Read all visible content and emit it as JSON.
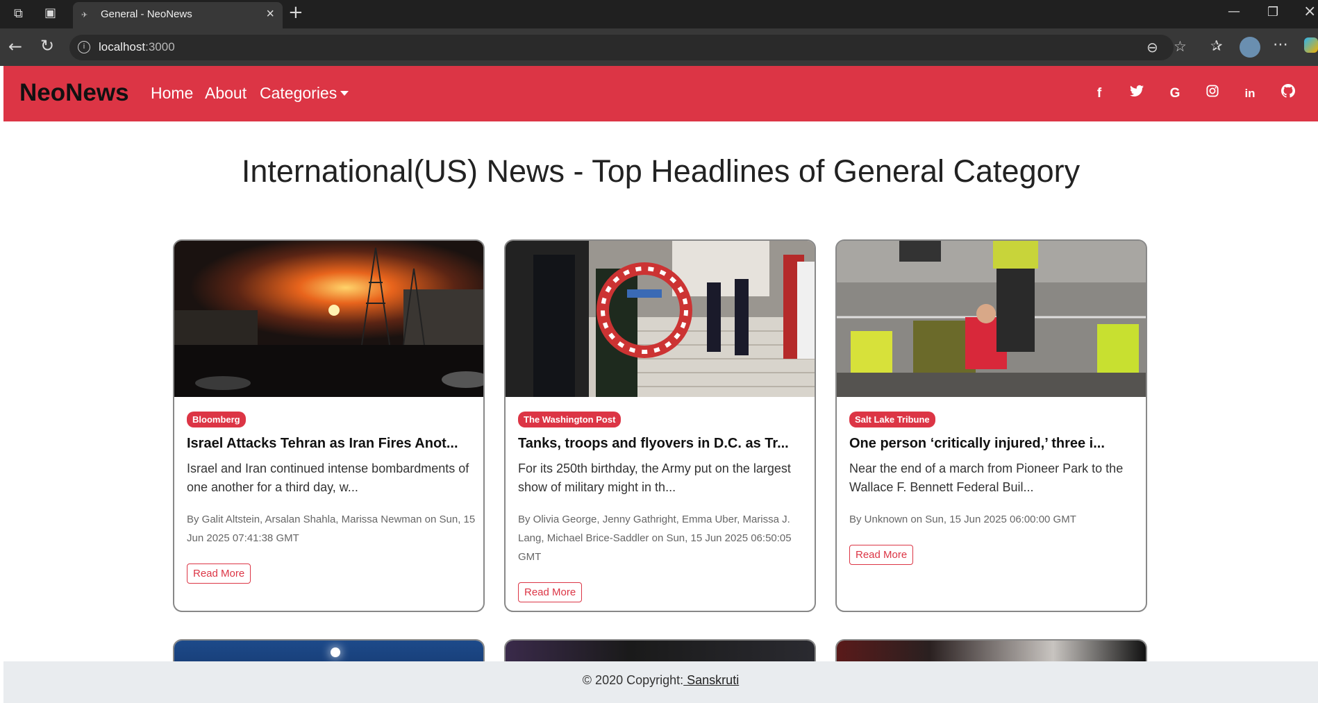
{
  "browser": {
    "tab_title": "General - NeoNews",
    "url_host": "localhost",
    "url_port": ":3000"
  },
  "navbar": {
    "brand": "NeoNews",
    "links": [
      "Home",
      "About",
      "Categories"
    ],
    "social": [
      "facebook-icon",
      "twitter-icon",
      "google-icon",
      "instagram-icon",
      "linkedin-icon",
      "github-icon"
    ]
  },
  "page": {
    "heading": "International(US) News - Top Headlines of General Category"
  },
  "articles": [
    {
      "source": "Bloomberg",
      "title": "Israel Attacks Tehran as Iran Fires Anot...",
      "description": "Israel and Iran continued intense bombardments of one another for a third day, w...",
      "meta": "By Galit Altstein, Arsalan Shahla, Marissa Newman on Sun, 15 Jun 2025 07:41:38 GMT",
      "button": "Read More"
    },
    {
      "source": "The Washington Post",
      "title": "Tanks, troops and flyovers in D.C. as Tr...",
      "description": "For its 250th birthday, the Army put on the largest show of military might in th...",
      "meta": "By Olivia George, Jenny Gathright, Emma Uber, Marissa J. Lang, Michael Brice-Saddler on Sun, 15 Jun 2025 06:50:05 GMT",
      "button": "Read More"
    },
    {
      "source": "Salt Lake Tribune",
      "title": "One person ‘critically injured,’ three i...",
      "description": "Near the end of a march from Pioneer Park to the Wallace F. Bennett Federal Buil...",
      "meta": "By Unknown on Sun, 15 Jun 2025 06:00:00 GMT",
      "button": "Read More"
    }
  ],
  "footer": {
    "text": "© 2020 Copyright:",
    "link": " Sanskruti"
  },
  "colors": {
    "accent": "#dc3545"
  }
}
